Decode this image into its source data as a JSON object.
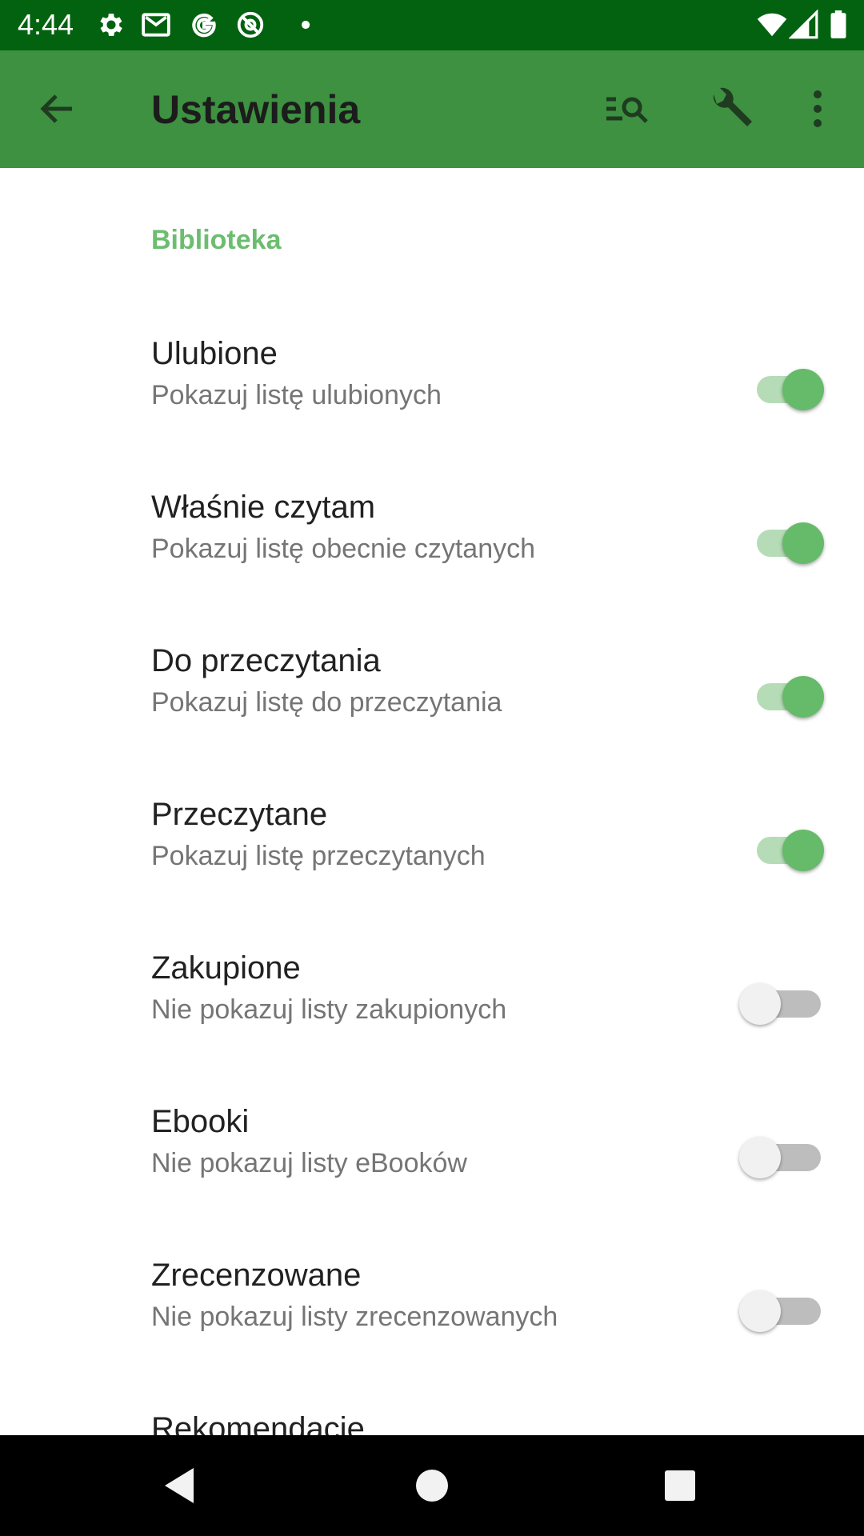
{
  "status_bar": {
    "time": "4:44",
    "icons": [
      "gear-icon",
      "gmail-icon",
      "google-icon",
      "at-icon",
      "dot-icon",
      "wifi-icon",
      "signal-icon",
      "battery-icon"
    ]
  },
  "app_bar": {
    "title": "Ustawienia",
    "actions": [
      "back-arrow-icon",
      "search-list-icon",
      "wrench-icon",
      "more-vert-icon"
    ],
    "background": "#3d9140"
  },
  "section": {
    "title": "Biblioteka",
    "color": "#6cbd6f"
  },
  "preferences": [
    {
      "title": "Ulubione",
      "summary": "Pokazuj listę ulubionych",
      "enabled": true
    },
    {
      "title": "Właśnie czytam",
      "summary": "Pokazuj listę obecnie czytanych",
      "enabled": true
    },
    {
      "title": "Do przeczytania",
      "summary": "Pokazuj listę do przeczytania",
      "enabled": true
    },
    {
      "title": "Przeczytane",
      "summary": "Pokazuj listę przeczytanych",
      "enabled": true
    },
    {
      "title": "Zakupione",
      "summary": "Nie pokazuj listy zakupionych",
      "enabled": false
    },
    {
      "title": "Ebooki",
      "summary": "Nie pokazuj listy eBooków",
      "enabled": false
    },
    {
      "title": "Zrecenzowane",
      "summary": "Nie pokazuj listy zrecenzowanych",
      "enabled": false
    },
    {
      "title": "Rekomendacje",
      "summary": "",
      "enabled": true
    }
  ],
  "nav_bar": {
    "buttons": [
      "back-triangle-icon",
      "home-circle-icon",
      "recents-square-icon"
    ]
  }
}
